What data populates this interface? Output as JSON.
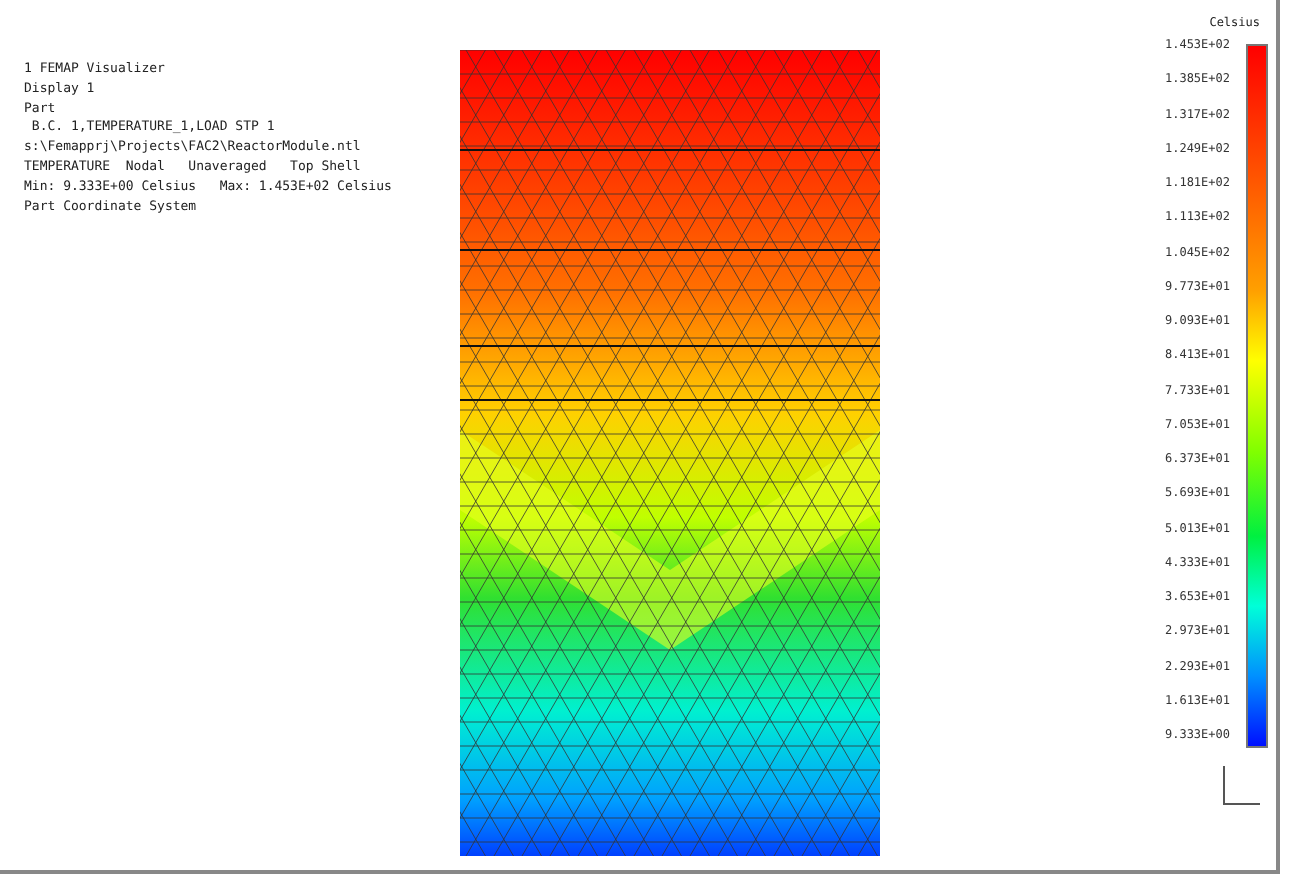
{
  "info_lines": [
    "1 FEMAP Visualizer",
    "Display 1",
    "Part",
    " B.C. 1,TEMPERATURE_1,LOAD STP 1",
    "s:\\Femapprj\\Projects\\FAC2\\ReactorModule.ntl",
    "TEMPERATURE  Nodal   Unaveraged   Top Shell",
    "Min: 9.333E+00 Celsius   Max: 1.453E+02 Celsius",
    "Part Coordinate System"
  ],
  "legend": {
    "title": "Celsius",
    "labels": [
      "1.453E+02",
      "1.385E+02",
      "1.317E+02",
      "1.249E+02",
      "1.181E+02",
      "1.113E+02",
      "1.045E+02",
      "9.773E+01",
      "9.093E+01",
      "8.413E+01",
      "7.733E+01",
      "7.053E+01",
      "6.373E+01",
      "5.693E+01",
      "5.013E+01",
      "4.333E+01",
      "3.653E+01",
      "2.973E+01",
      "2.293E+01",
      "1.613E+01",
      "9.333E+00"
    ]
  }
}
